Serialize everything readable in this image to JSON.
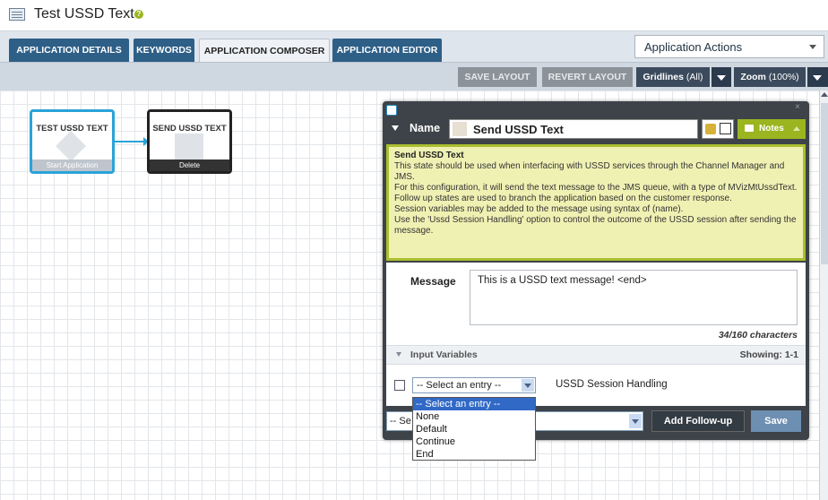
{
  "app": {
    "title": "Test USSD Text"
  },
  "tabs": [
    {
      "label": "APPLICATION DETAILS"
    },
    {
      "label": "KEYWORDS"
    },
    {
      "label": "APPLICATION COMPOSER",
      "active": true
    },
    {
      "label": "APPLICATION EDITOR"
    }
  ],
  "actions_dropdown": {
    "label": "Application Actions"
  },
  "toolbar": {
    "save_layout": "SAVE LAYOUT",
    "revert_layout": "REVERT LAYOUT",
    "gridlines_label": "Gridlines",
    "gridlines_value": "(All)",
    "zoom_label": "Zoom",
    "zoom_value": "(100%)"
  },
  "nodes": [
    {
      "label": "TEST USSD TEXT",
      "footer": "Start Application"
    },
    {
      "label": "SEND USSD TEXT",
      "footer": "Delete"
    }
  ],
  "panel": {
    "name_label": "Name",
    "name_value": "Send USSD Text",
    "notes_label": "Notes",
    "notes": {
      "heading": "Send USSD Text",
      "lines": [
        "This state should be used when interfacing with USSD services through the Channel Manager and JMS.",
        "For this configuration, it will send the text message to the JMS queue, with a type of MVizMtUssdText.",
        "Follow up states are used to branch the application based on the customer response.",
        "Session variables may be added to the message using syntax of (name).",
        "Use the 'Ussd Session Handling' option to control the outcome of the USSD session after sending the message."
      ]
    },
    "message_label": "Message",
    "message_value": "This is a USSD text message! <end>",
    "char_count": "34/160 characters",
    "input_variables_label": "Input Variables",
    "showing": "Showing: 1-1",
    "entry_select_value": "-- Select an entry --",
    "session_handling_label": "USSD Session Handling",
    "followup_select_value": "-- Se",
    "add_followup": "Add Follow-up",
    "save": "Save"
  },
  "dropdown_options": [
    "-- Select an entry --",
    "None",
    "Default",
    "Continue",
    "End"
  ],
  "colors": {
    "accent_blue": "#2aa3d8",
    "notes_green": "#9ab520",
    "tab_blue": "#2e5f87"
  }
}
